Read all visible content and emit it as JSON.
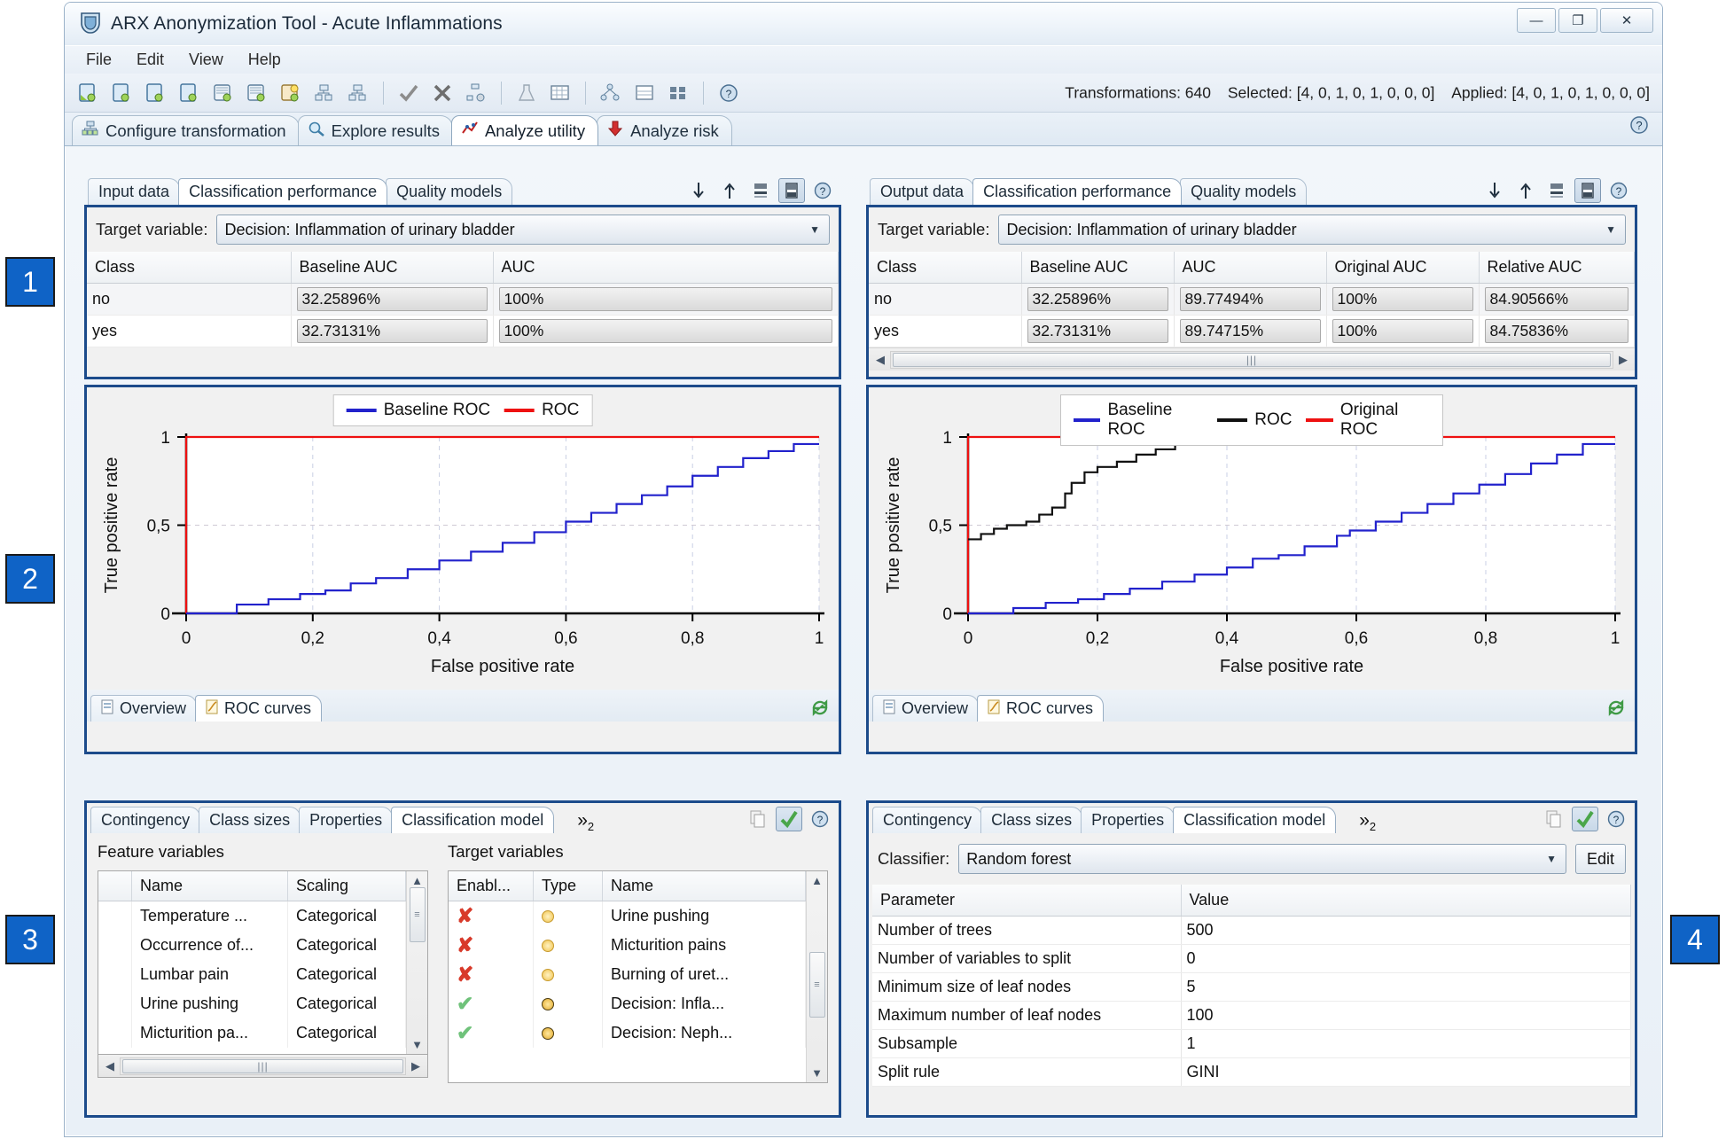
{
  "window": {
    "title": "ARX Anonymization Tool - Acute Inflammations",
    "app_icon": "shield-icon",
    "minimize": "—",
    "maximize": "❐",
    "close": "✕"
  },
  "menubar": {
    "items": [
      "File",
      "Edit",
      "View",
      "Help"
    ]
  },
  "toolbar": {
    "status": {
      "transformations_label": "Transformations: 640",
      "selected_label": "Selected: [4, 0, 1, 0, 1, 0, 0, 0]",
      "applied_label": "Applied: [4, 0, 1, 0, 1, 0, 0, 0]"
    }
  },
  "main_tabs": [
    {
      "label": "Configure transformation",
      "icon": "hierarchy-icon",
      "active": false
    },
    {
      "label": "Explore results",
      "icon": "magnifier-icon",
      "active": false
    },
    {
      "label": "Analyze utility",
      "icon": "chart-icon",
      "active": true
    },
    {
      "label": "Analyze risk",
      "icon": "down-arrow-icon",
      "active": false
    }
  ],
  "badges": [
    {
      "label": "1"
    },
    {
      "label": "2"
    },
    {
      "label": "3"
    },
    {
      "label": "4"
    }
  ],
  "left_panel": {
    "tabs": [
      {
        "label": "Input data",
        "active": false
      },
      {
        "label": "Classification performance",
        "active": true
      },
      {
        "label": "Quality models",
        "active": false
      }
    ],
    "tools": [
      "sort-down-icon",
      "sort-up-icon",
      "rows-layout-icon",
      "columns-layout-icon",
      "help-icon"
    ],
    "target_variable": {
      "label": "Target variable:",
      "value": "Decision: Inflammation of urinary bladder"
    },
    "table": {
      "columns": [
        "Class",
        "Baseline AUC",
        "AUC"
      ],
      "rows": [
        [
          "no",
          "32.25896%",
          "100%"
        ],
        [
          "yes",
          "32.73131%",
          "100%"
        ]
      ]
    },
    "chart_tabs": [
      {
        "label": "Overview",
        "icon": "overview-icon",
        "active": false
      },
      {
        "label": "ROC curves",
        "icon": "roc-icon",
        "active": true
      }
    ],
    "refresh_icon": "refresh-icon"
  },
  "right_panel": {
    "tabs": [
      {
        "label": "Output data",
        "active": false
      },
      {
        "label": "Classification performance",
        "active": true
      },
      {
        "label": "Quality models",
        "active": false
      }
    ],
    "tools": [
      "sort-down-icon",
      "sort-up-icon",
      "rows-layout-icon",
      "columns-layout-icon",
      "help-icon"
    ],
    "target_variable": {
      "label": "Target variable:",
      "value": "Decision: Inflammation of urinary bladder"
    },
    "table": {
      "columns": [
        "Class",
        "Baseline AUC",
        "AUC",
        "Original AUC",
        "Relative AUC"
      ],
      "rows": [
        [
          "no",
          "32.25896%",
          "89.77494%",
          "100%",
          "84.90566%"
        ],
        [
          "yes",
          "32.73131%",
          "89.74715%",
          "100%",
          "84.75836%"
        ]
      ]
    },
    "chart_tabs": [
      {
        "label": "Overview",
        "icon": "overview-icon",
        "active": false
      },
      {
        "label": "ROC curves",
        "icon": "roc-icon",
        "active": true
      }
    ],
    "refresh_icon": "refresh-icon"
  },
  "bottom_left": {
    "tabs": [
      {
        "label": "Contingency",
        "active": false
      },
      {
        "label": "Class sizes",
        "active": false
      },
      {
        "label": "Properties",
        "active": false
      },
      {
        "label": "Classification model",
        "active": true
      }
    ],
    "overflow_label": "»",
    "overflow_count": "2",
    "tools": [
      "copy-icon",
      "apply-check-icon",
      "help-icon"
    ],
    "feature_variables": {
      "title": "Feature variables",
      "columns": [
        "Name",
        "Scaling"
      ],
      "rows": [
        [
          "Temperature ...",
          "Categorical"
        ],
        [
          "Occurrence of...",
          "Categorical"
        ],
        [
          "Lumbar pain",
          "Categorical"
        ],
        [
          "Urine pushing",
          "Categorical"
        ],
        [
          "Micturition pa...",
          "Categorical"
        ]
      ]
    },
    "target_variables": {
      "title": "Target variables",
      "columns": [
        "Enabl...",
        "Type",
        "Name"
      ],
      "rows": [
        {
          "enabled": "x",
          "type": "dim",
          "name": "Urine pushing"
        },
        {
          "enabled": "x",
          "type": "dim",
          "name": "Micturition pains"
        },
        {
          "enabled": "x",
          "type": "dim",
          "name": "Burning of uret..."
        },
        {
          "enabled": "check",
          "type": "strong",
          "name": "Decision: Infla..."
        },
        {
          "enabled": "check",
          "type": "strong",
          "name": "Decision: Neph..."
        }
      ]
    }
  },
  "bottom_right": {
    "tabs": [
      {
        "label": "Contingency",
        "active": false
      },
      {
        "label": "Class sizes",
        "active": false
      },
      {
        "label": "Properties",
        "active": false
      },
      {
        "label": "Classification model",
        "active": true
      }
    ],
    "overflow_label": "»",
    "overflow_count": "2",
    "tools": [
      "copy-icon",
      "apply-check-icon",
      "help-icon"
    ],
    "classifier": {
      "label": "Classifier:",
      "value": "Random forest",
      "edit_label": "Edit"
    },
    "parameters": {
      "columns": [
        "Parameter",
        "Value"
      ],
      "rows": [
        [
          "Number of trees",
          "500"
        ],
        [
          "Number of variables to split",
          "0"
        ],
        [
          "Minimum size of leaf nodes",
          "5"
        ],
        [
          "Maximum number of leaf nodes",
          "100"
        ],
        [
          "Subsample",
          "1"
        ],
        [
          "Split rule",
          "GINI"
        ]
      ]
    }
  },
  "colors": {
    "baseline_roc": "#2222cc",
    "roc_left": "#ee1111",
    "roc_right": "#111111",
    "original_roc": "#ee1111",
    "badge": "#0f63c6",
    "section_border": "#1c4b8b"
  },
  "chart_data": [
    {
      "type": "line",
      "id": "left-roc",
      "title": "",
      "xlabel": "False positive rate",
      "ylabel": "True positive rate",
      "xlim": [
        0,
        1
      ],
      "ylim": [
        0,
        1
      ],
      "xticks": [
        "0",
        "0,2",
        "0,4",
        "0,6",
        "0,8",
        "1"
      ],
      "yticks": [
        "0",
        "0,5",
        "1"
      ],
      "grid": true,
      "legend_position": "top-center",
      "series": [
        {
          "name": "Baseline ROC",
          "color": "#2222cc",
          "x": [
            0.0,
            0.08,
            0.08,
            0.13,
            0.13,
            0.18,
            0.18,
            0.22,
            0.22,
            0.26,
            0.26,
            0.3,
            0.3,
            0.35,
            0.35,
            0.4,
            0.4,
            0.45,
            0.45,
            0.5,
            0.5,
            0.55,
            0.55,
            0.6,
            0.6,
            0.64,
            0.64,
            0.68,
            0.68,
            0.72,
            0.72,
            0.76,
            0.76,
            0.8,
            0.8,
            0.84,
            0.84,
            0.88,
            0.88,
            0.92,
            0.92,
            0.96,
            0.96,
            1.0
          ],
          "y": [
            0.0,
            0.0,
            0.05,
            0.05,
            0.08,
            0.08,
            0.11,
            0.11,
            0.13,
            0.13,
            0.17,
            0.17,
            0.2,
            0.2,
            0.25,
            0.25,
            0.3,
            0.3,
            0.35,
            0.35,
            0.4,
            0.4,
            0.46,
            0.46,
            0.52,
            0.52,
            0.57,
            0.57,
            0.62,
            0.62,
            0.67,
            0.67,
            0.72,
            0.72,
            0.78,
            0.78,
            0.83,
            0.83,
            0.88,
            0.88,
            0.92,
            0.92,
            0.96,
            0.96
          ]
        },
        {
          "name": "ROC",
          "color": "#ee1111",
          "x": [
            0.0,
            0.0,
            1.0
          ],
          "y": [
            0.0,
            1.0,
            1.0
          ]
        }
      ]
    },
    {
      "type": "line",
      "id": "right-roc",
      "title": "",
      "xlabel": "False positive rate",
      "ylabel": "True positive rate",
      "xlim": [
        0,
        1
      ],
      "ylim": [
        0,
        1
      ],
      "xticks": [
        "0",
        "0,2",
        "0,4",
        "0,6",
        "0,8",
        "1"
      ],
      "yticks": [
        "0",
        "0,5",
        "1"
      ],
      "grid": true,
      "legend_position": "top-center",
      "series": [
        {
          "name": "Baseline ROC",
          "color": "#2222cc",
          "x": [
            0.0,
            0.07,
            0.07,
            0.12,
            0.12,
            0.17,
            0.17,
            0.21,
            0.21,
            0.25,
            0.25,
            0.3,
            0.3,
            0.35,
            0.35,
            0.4,
            0.4,
            0.44,
            0.44,
            0.48,
            0.48,
            0.52,
            0.52,
            0.57,
            0.57,
            0.59,
            0.59,
            0.63,
            0.63,
            0.67,
            0.67,
            0.71,
            0.71,
            0.75,
            0.75,
            0.79,
            0.79,
            0.83,
            0.83,
            0.87,
            0.87,
            0.91,
            0.91,
            0.95,
            0.95,
            1.0
          ],
          "y": [
            0.0,
            0.0,
            0.03,
            0.03,
            0.06,
            0.06,
            0.08,
            0.08,
            0.11,
            0.11,
            0.14,
            0.14,
            0.18,
            0.18,
            0.22,
            0.22,
            0.26,
            0.26,
            0.31,
            0.31,
            0.33,
            0.33,
            0.38,
            0.38,
            0.44,
            0.44,
            0.47,
            0.47,
            0.52,
            0.52,
            0.57,
            0.57,
            0.62,
            0.62,
            0.68,
            0.68,
            0.73,
            0.73,
            0.79,
            0.79,
            0.85,
            0.85,
            0.9,
            0.9,
            0.96,
            0.96
          ]
        },
        {
          "name": "ROC",
          "color": "#111111",
          "x": [
            0.0,
            0.02,
            0.02,
            0.04,
            0.04,
            0.06,
            0.06,
            0.09,
            0.09,
            0.11,
            0.11,
            0.13,
            0.13,
            0.15,
            0.15,
            0.16,
            0.16,
            0.18,
            0.18,
            0.2,
            0.2,
            0.23,
            0.23,
            0.26,
            0.26,
            0.29,
            0.29,
            0.32,
            0.32
          ],
          "y": [
            0.42,
            0.42,
            0.45,
            0.45,
            0.48,
            0.48,
            0.5,
            0.5,
            0.52,
            0.52,
            0.56,
            0.56,
            0.6,
            0.6,
            0.68,
            0.68,
            0.74,
            0.74,
            0.8,
            0.8,
            0.83,
            0.83,
            0.86,
            0.86,
            0.9,
            0.9,
            0.93,
            0.93,
            1.0
          ]
        },
        {
          "name": "Original ROC",
          "color": "#ee1111",
          "x": [
            0.0,
            0.0,
            1.0
          ],
          "y": [
            0.0,
            1.0,
            1.0
          ]
        }
      ]
    }
  ]
}
